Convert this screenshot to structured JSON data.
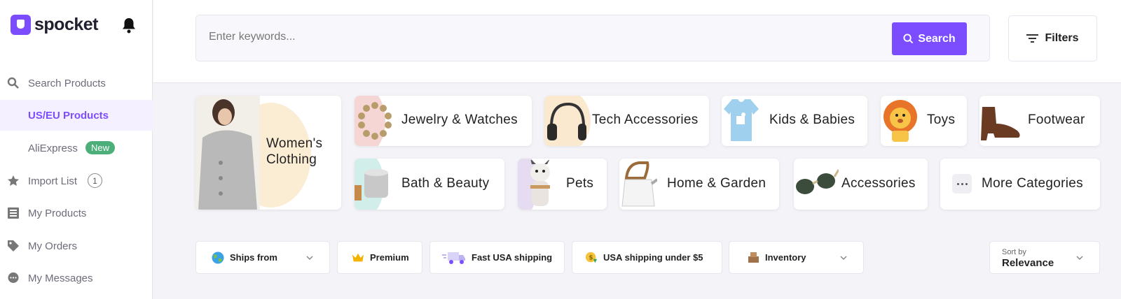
{
  "brand": {
    "name": "spocket",
    "color": "#7c4dff"
  },
  "sidebar": {
    "items": [
      {
        "label": "Search Products",
        "icon": "search-icon"
      },
      {
        "label": "US/EU Products",
        "icon": "",
        "active": true
      },
      {
        "label": "AliExpress",
        "icon": "",
        "badge": "New"
      },
      {
        "label": "Import List",
        "icon": "star-icon",
        "count": "1"
      },
      {
        "label": "My Products",
        "icon": "list-icon"
      },
      {
        "label": "My Orders",
        "icon": "tag-icon"
      },
      {
        "label": "My Messages",
        "icon": "chat-icon"
      }
    ]
  },
  "search": {
    "placeholder": "Enter keywords...",
    "value": "",
    "button_label": "Search"
  },
  "filters_label": "Filters",
  "categories": [
    {
      "name": "Women's Clothing"
    },
    {
      "name": "Jewelry & Watches"
    },
    {
      "name": "Tech Accessories"
    },
    {
      "name": "Kids & Babies"
    },
    {
      "name": "Toys"
    },
    {
      "name": "Footwear"
    },
    {
      "name": "Bath & Beauty"
    },
    {
      "name": "Pets"
    },
    {
      "name": "Home & Garden"
    },
    {
      "name": "Accessories"
    },
    {
      "name": "More Categories"
    }
  ],
  "filter_pills": [
    {
      "label": "Ships from",
      "icon": "globe-icon",
      "dropdown": true
    },
    {
      "label": "Premium",
      "icon": "crown-icon"
    },
    {
      "label": "Fast USA shipping",
      "icon": "truck-icon"
    },
    {
      "label": "USA shipping under $5",
      "icon": "coin-icon"
    },
    {
      "label": "Inventory",
      "icon": "box-icon",
      "dropdown": true
    }
  ],
  "sort": {
    "label": "Sort by",
    "value": "Relevance"
  }
}
